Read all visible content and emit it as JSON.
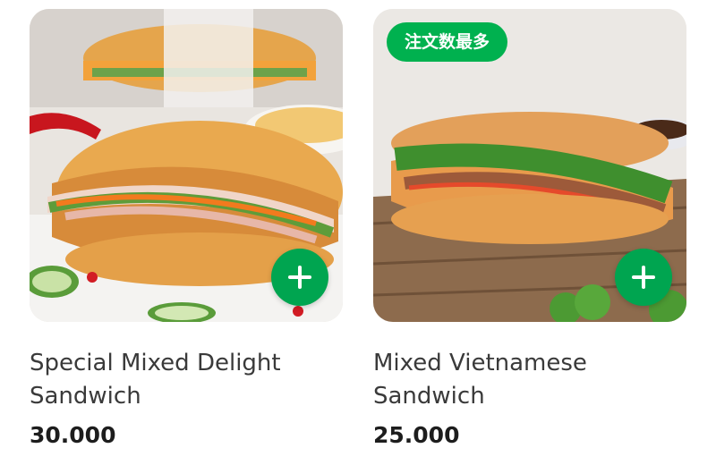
{
  "products": [
    {
      "name_line1": "Special Mixed Delight",
      "name_line2": "Sandwich",
      "price": "30.000",
      "image": "banh-mi-special-photo"
    },
    {
      "badge": "注文数最多",
      "name_line1": "Mixed Vietnamese",
      "name_line2": "Sandwich",
      "price": "25.000",
      "image": "banh-mi-mixed-photo"
    }
  ],
  "colors": {
    "accent_green": "#00a550",
    "badge_green": "#00b14f",
    "text_primary": "#3a3a3a",
    "price_text": "#1d1d1d"
  },
  "icons": {
    "add_button": "plus-icon"
  }
}
